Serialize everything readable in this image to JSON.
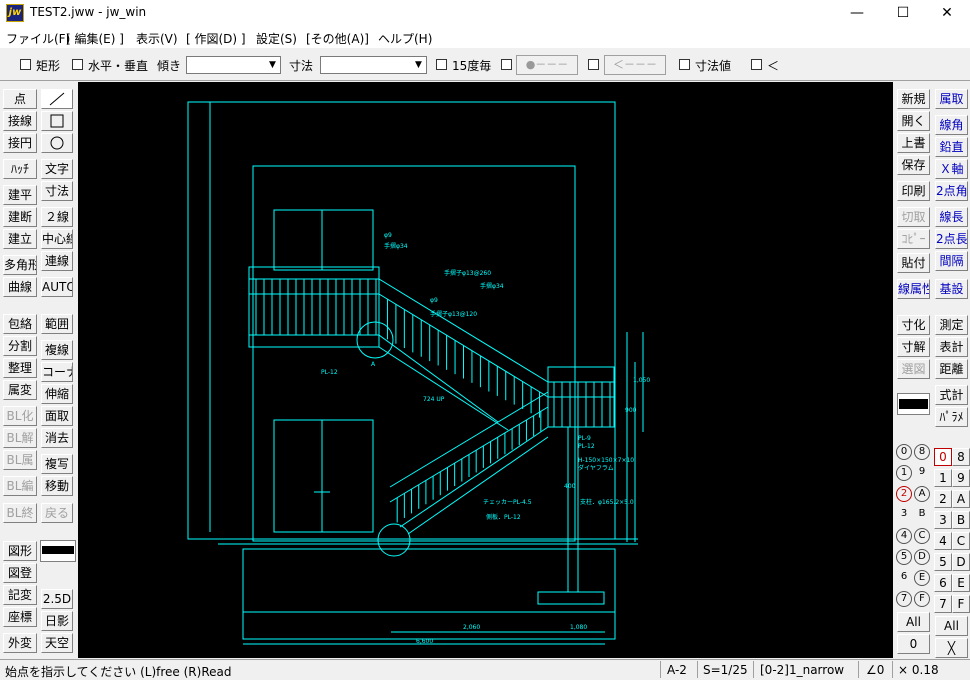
{
  "window": {
    "title": "TEST2.jww - jw_win",
    "icon_label": "jw",
    "minimize": "—",
    "maximize": "☐",
    "close": "✕"
  },
  "menu": [
    "ファイル(F)",
    "[ 編集(E) ]",
    "表示(V)",
    "[ 作図(D) ]",
    "設定(S)",
    "[その他(A)]",
    "ヘルプ(H)"
  ],
  "toolbar": {
    "rect": "矩形",
    "hv": "水平・垂直",
    "tilt": "傾き",
    "dim": "寸法",
    "deg15": "15度毎",
    "pt_btn": "●－－－",
    "lt_btn": "＜－－－",
    "dimval": "寸法値",
    "lt": "＜"
  },
  "left_col1": [
    "点",
    "接線",
    "接円",
    "ﾊｯﾁ",
    "建平",
    "建断",
    "建立",
    "多角形",
    "曲線",
    "包絡",
    "分割",
    "整理",
    "属変",
    "BL化",
    "BL解",
    "BL属",
    "BL編",
    "BL終",
    "図形",
    "図登",
    "記変",
    "座標",
    "外変"
  ],
  "left_col2": [
    "文字",
    "寸法",
    "２線",
    "中心線",
    "連線",
    "AUTO",
    "範囲",
    "複線",
    "コーナー",
    "伸縮",
    "面取",
    "消去",
    "複写",
    "移動",
    "戻る",
    "2.5D",
    "日影",
    "天空"
  ],
  "right_col1": [
    "新規",
    "開く",
    "上書",
    "保存",
    "印刷",
    "切取",
    "ｺﾋﾟｰ",
    "貼付",
    "線属性",
    "寸化",
    "寸解",
    "選図"
  ],
  "right_col2": [
    "属取",
    "線角",
    "鉛直",
    "Ｘ軸",
    "2点角",
    "線長",
    "2点長",
    "間隔",
    "基設",
    "測定",
    "表計",
    "距離",
    "式計",
    "ﾊﾟﾗﾒ"
  ],
  "layer_groups": [
    "0",
    "8",
    "1",
    "9",
    "2",
    "A",
    "3",
    "B",
    "4",
    "C",
    "5",
    "D",
    "6",
    "E",
    "7",
    "F"
  ],
  "layers": [
    "0",
    "8",
    "1",
    "9",
    "2",
    "A",
    "3",
    "B",
    "4",
    "C",
    "5",
    "D",
    "6",
    "E",
    "7",
    "F"
  ],
  "layer_all_left": "All",
  "layer_zero_left": "0",
  "layer_all_right": "All",
  "layer_x_right": "╳",
  "drawing_text": {
    "phi9a": "φ9",
    "rail24a": "手摺φ34",
    "rail13a": "手摺子φ13@260",
    "rail24b": "手摺φ34",
    "phi9b": "φ9",
    "rail13b": "手摺子φ13@120",
    "pl12a": "PL-12",
    "markA": "A",
    "up724": "724 UP",
    "pl9": "PL-9",
    "pl12b": "PL-12",
    "hbeam": "H-150×150×7×10",
    "diaphragm": "ダイヤフラム",
    "checker": "チェッカーPL-4.5",
    "sideplate": "側板．PL-12",
    "column": "支柱．φ165.2×5.0",
    "dim2060": "2,060",
    "dim1080": "1,080",
    "dim6600": "6,600",
    "dim400": "400",
    "dim900": "900",
    "dim1050": "1,050"
  },
  "status": {
    "prompt": "始点を指示してください (L)free (R)Read",
    "paper": "A-2",
    "scale": "S=1/25",
    "layer": "[0-2]1_narrow",
    "angle": "∠0",
    "mag": "× 0.18"
  },
  "colors": {
    "cad_line": "#00ffff",
    "cad_bg": "#000000",
    "layer_active": "#c00000"
  }
}
